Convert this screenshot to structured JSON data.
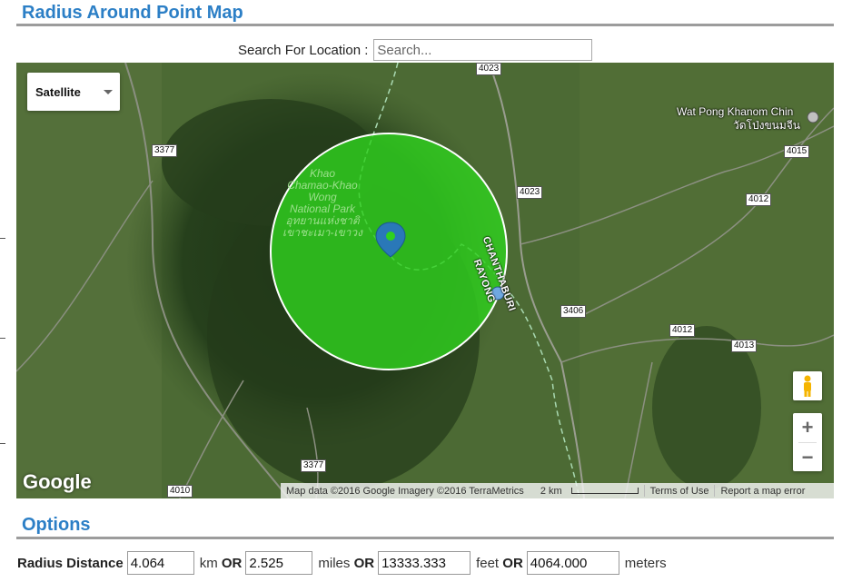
{
  "page": {
    "title": "Radius Around Point Map"
  },
  "search": {
    "label": "Search For Location :",
    "placeholder": "Search..."
  },
  "map": {
    "map_type": "Satellite",
    "roads": [
      "4023",
      "3377",
      "4023",
      "4015",
      "4012",
      "3406",
      "4012",
      "4013",
      "3377",
      "4010"
    ],
    "places": {
      "temple": "Wat Pong Khanom Chin",
      "temple_thai": "วัดโป่งขนมจีน",
      "park_name": "Khao Chamao-Khao Wong National Park",
      "park_lines": [
        "Khao",
        "Chamao-Khao",
        "Wong",
        "National Park",
        "อุทยานแห่งชาติ",
        "เขาชะเมา-เขาวง"
      ],
      "province_1": "CHANTHABURI",
      "province_2": "RAYONG"
    },
    "zoom_in": "+",
    "zoom_out": "−",
    "logo": "Google",
    "attribution": "Map data ©2016 Google Imagery ©2016 TerraMetrics",
    "scale": "2 km",
    "terms": "Terms of Use",
    "report": "Report a map error",
    "circle_color": "#2fd11e"
  },
  "options": {
    "title": "Options",
    "radius_label": "Radius Distance",
    "km_value": "4.064",
    "km_unit": "km",
    "or1": "OR",
    "miles_value": "2.525",
    "miles_unit": "miles",
    "or2": "OR",
    "feet_value": "13333.333",
    "feet_unit": "feet",
    "or3": "OR",
    "meters_value": "4064.000",
    "meters_unit": "meters"
  }
}
